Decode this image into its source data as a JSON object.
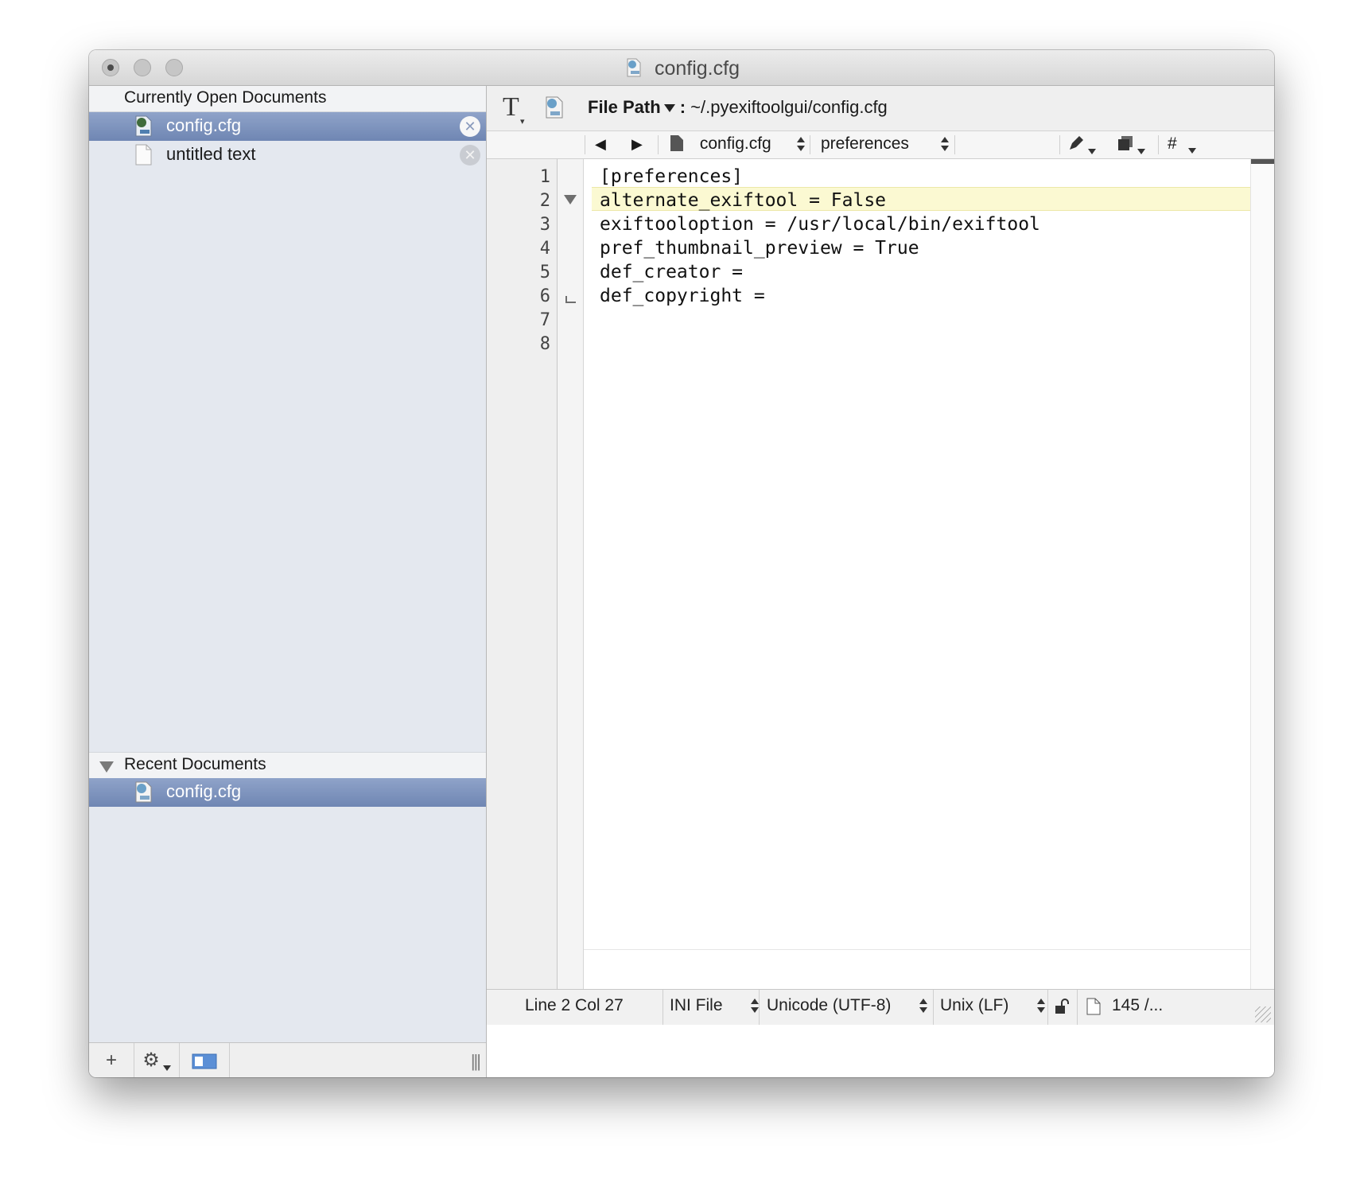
{
  "window": {
    "title": "config.cfg"
  },
  "sidebar": {
    "open_header": "Currently Open Documents",
    "open_items": [
      {
        "label": "config.cfg",
        "selected": true,
        "icon": "config-file-icon"
      },
      {
        "label": "untitled text",
        "selected": false,
        "icon": "text-document-icon"
      }
    ],
    "recent_header": "Recent Documents",
    "recent_items": [
      {
        "label": "config.cfg",
        "selected": true,
        "icon": "config-file-icon"
      }
    ],
    "footer": {
      "add_label": "+",
      "gear_label": "⚙",
      "grip_label": "|||"
    }
  },
  "toolbar": {
    "text_tool_label": "T",
    "file_path_label": "File Path",
    "file_path_separator": ":",
    "file_path_value": "~/.pyexiftoolgui/config.cfg"
  },
  "navbar": {
    "back_label": "◀",
    "forward_label": "▶",
    "file_selector": "config.cfg",
    "section_selector": "preferences",
    "hash_label": "#"
  },
  "editor": {
    "line_numbers": [
      "1",
      "2",
      "3",
      "4",
      "5",
      "6",
      "7",
      "8"
    ],
    "lines": [
      "[preferences]",
      "alternate_exiftool = False",
      "exiftooloption = /usr/local/bin/exiftool",
      "pref_thumbnail_preview = True",
      "def_creator =",
      "def_copyright =",
      "",
      ""
    ],
    "current_line": 2
  },
  "status": {
    "position": "Line 2 Col 27",
    "language": "INI File",
    "encoding": "Unicode (UTF-8)",
    "line_endings": "Unix (LF)",
    "size": "145 /..."
  },
  "colors": {
    "selection": "#7189b6",
    "current_line_highlight": "#fbf9d2",
    "sidebar_bg": "#e4e8ef"
  }
}
